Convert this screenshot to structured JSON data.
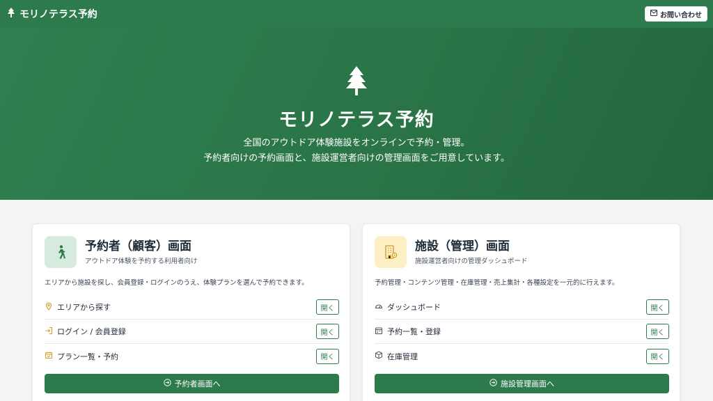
{
  "header": {
    "brand": "モリノテラス予約",
    "contact_label": "お問い合わせ",
    "brand_icon": "tree-icon",
    "contact_icon": "mail-icon"
  },
  "hero": {
    "title": "モリノテラス予約",
    "line1": "全国のアウトドア体験施設をオンラインで予約・管理。",
    "line2": "予約者向けの予約画面と、施設運営者向けの管理画面をご用意しています。"
  },
  "cards": [
    {
      "title": "予約者（顧客）画面",
      "subtitle": "アウトドア体験を予約する利用者向け",
      "description": "エリアから施設を探し、会員登録・ログインのうえ、体験プランを選んで予約できます。",
      "icon": "walking-person-icon",
      "items": [
        {
          "label": "エリアから探す",
          "icon": "map-pin-icon",
          "button": "開く"
        },
        {
          "label": "ログイン / 会員登録",
          "icon": "login-icon",
          "button": "開く"
        },
        {
          "label": "プラン一覧・予約",
          "icon": "calendar-icon",
          "button": "開く"
        }
      ],
      "main_button": "予約者画面へ"
    },
    {
      "title": "施設（管理）画面",
      "subtitle": "施設運営者向けの管理ダッシュボード",
      "description": "予約管理・コンテンツ管理・在庫管理・売上集計・各種設定を一元的に行えます。",
      "icon": "building-gear-icon",
      "items": [
        {
          "label": "ダッシュボード",
          "icon": "gauge-icon",
          "button": "開く"
        },
        {
          "label": "予約一覧・登録",
          "icon": "calendar-list-icon",
          "button": "開く"
        },
        {
          "label": "在庫管理",
          "icon": "box-icon",
          "button": "開く"
        }
      ],
      "main_button": "施設管理画面へ"
    }
  ],
  "colors": {
    "primary": "#2d7a4c",
    "accent_yellow": "#d49a2a",
    "background": "#f3f4f6"
  }
}
